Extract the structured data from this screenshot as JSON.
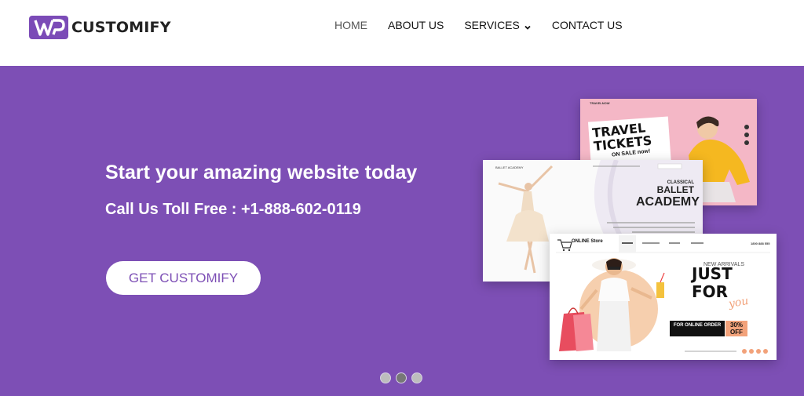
{
  "brand": {
    "name": "CUSTOMIFY",
    "logo_icon": "wp-logo-icon",
    "accent": "#7d4fb5"
  },
  "nav": {
    "items": [
      {
        "label": "HOME",
        "active": true
      },
      {
        "label": "ABOUT US",
        "active": false
      },
      {
        "label": "SERVICES",
        "active": false,
        "has_dropdown": true
      },
      {
        "label": "CONTACT US",
        "active": false
      }
    ]
  },
  "hero": {
    "title": "Start your amazing website today",
    "phone": "Call Us Toll Free : +1-888-602-0119",
    "cta_label": "GET CUSTOMIFY",
    "background": "#7d4fb5"
  },
  "mockups": {
    "travel": {
      "brand": "TRAVELNOW",
      "headline": "TRAVEL TICKETS",
      "sale": "ON SALE now!"
    },
    "ballet": {
      "brand": "BALLET ACADEMY",
      "l1": "CLASSICAL",
      "l2": "BALLET",
      "l3": "ACADEMY"
    },
    "shop": {
      "brand": "ONLINE Store",
      "new_arrivals": "NEW ARRIVALS",
      "title_line1": "JUST",
      "title_line2": "FOR",
      "script": "you",
      "badge": "FOR ONLINE ORDER",
      "off": "30% OFF",
      "phone": "1800 888 555"
    }
  },
  "carousel": {
    "count": 3,
    "active_index": 1
  }
}
